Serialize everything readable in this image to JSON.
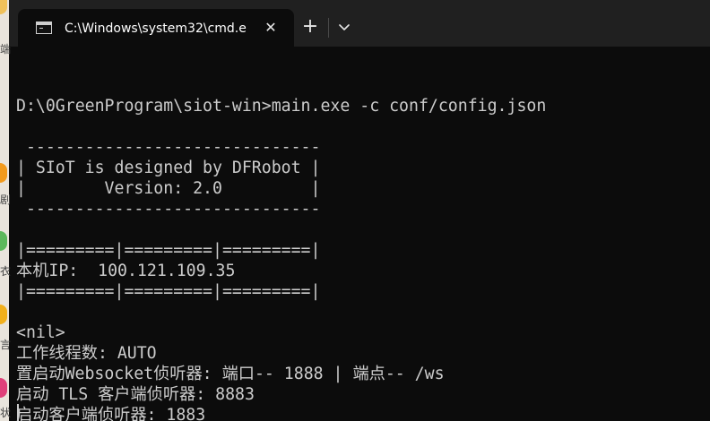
{
  "colors": {
    "console_background": "#0c0c0c",
    "console_text": "#cccccc",
    "titlebar_background": "#202020",
    "tab_text": "#ffffff"
  },
  "window": {
    "tab": {
      "icon": "terminal-icon",
      "title": "C:\\Windows\\system32\\cmd.e",
      "close_icon": "close-icon",
      "close_label": "✕"
    },
    "new_tab_icon": "plus-icon",
    "new_tab_label": "+",
    "dropdown_icon": "chevron-down-icon"
  },
  "console": {
    "lines": [
      "",
      "D:\\0GreenProgram\\siot-win>main.exe -c conf/config.json",
      "",
      " ------------------------------",
      "| SIoT is designed by DFRobot |",
      "|        Version: 2.0         |",
      " ------------------------------",
      "",
      "|=========|=========|=========|",
      "本机IP:  100.121.109.35",
      "|=========|=========|=========|",
      "",
      "<nil>",
      "工作线程数: AUTO",
      "置启动Websocket侦听器: 端口-- 1888 | 端点-- /ws",
      "启动 TLS 客户端侦听器: 8883",
      "启动客户端侦听器: 1883"
    ]
  },
  "desktop_edge": {
    "glyphs": [
      "端",
      "剧",
      "衣",
      "言",
      "状"
    ]
  }
}
